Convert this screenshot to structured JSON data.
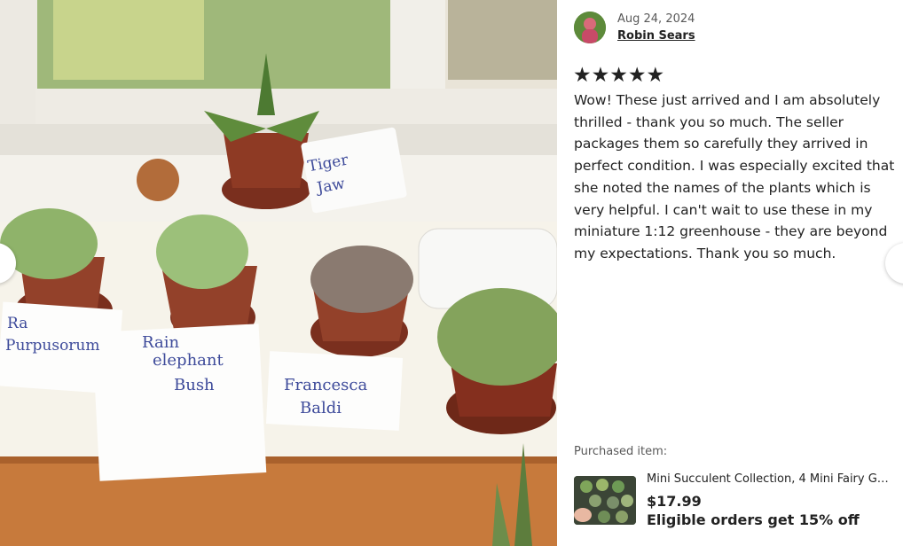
{
  "photo": {
    "description_icon": "succulent-photo",
    "tags": [
      "Tiger Jaw",
      "Rainbow Purpusorum",
      "Rainbow elephant Bush",
      "Francesca Baldi"
    ]
  },
  "review": {
    "date": "Aug 24, 2024",
    "author": "Robin Sears",
    "rating": 5,
    "stars_text": "★★★★★",
    "text": "Wow! These just arrived and I am absolutely thrilled - thank you so much. The seller packages them so carefully they arrived in perfect condition. I was especially excited that she noted the names of the plants which is very helpful. I can't wait to use these in my miniature 1:12 greenhouse - they are beyond my expectations. Thank you so much."
  },
  "purchased": {
    "label": "Purchased item:",
    "name": "Mini Succulent Collection, 4 Mini Fairy G…",
    "price": "$17.99",
    "promo": "Eligible orders get 15% off"
  },
  "colors": {
    "text": "#222222",
    "muted": "#595959"
  }
}
